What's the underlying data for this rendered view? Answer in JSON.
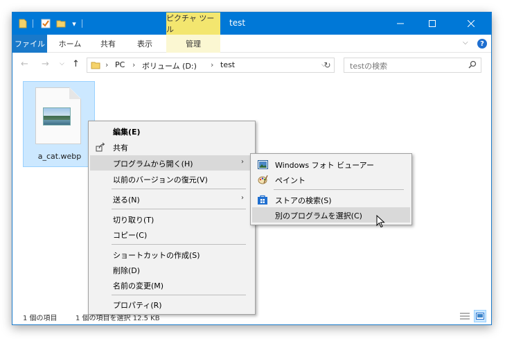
{
  "window": {
    "title": "test",
    "contextual_tab": "ピクチャ ツール",
    "qat_dropdown": "▾"
  },
  "ribbon": {
    "file": "ファイル",
    "home": "ホーム",
    "share": "共有",
    "view": "表示",
    "manage": "管理",
    "help": "?"
  },
  "address": {
    "segments": [
      "PC",
      "ボリューム (D:)",
      "test"
    ],
    "separator": "›",
    "search_placeholder": "testの検索"
  },
  "files": [
    {
      "name": "a_cat.webp",
      "icon": "image-file-icon",
      "selected": true
    }
  ],
  "status": {
    "count": "1 個の項目",
    "selected": "1 個の項目を選択  12.5 KB"
  },
  "context_menu": {
    "items": [
      {
        "label": "編集(E)",
        "bold": true
      },
      {
        "label": "共有",
        "icon": "share-icon"
      },
      {
        "label": "プログラムから開く(H)",
        "submenu": true,
        "highlighted": true
      },
      {
        "label": "以前のバージョンの復元(V)"
      },
      {
        "label": "送る(N)",
        "submenu": true
      },
      {
        "label": "切り取り(T)"
      },
      {
        "label": "コピー(C)"
      },
      {
        "label": "ショートカットの作成(S)"
      },
      {
        "label": "削除(D)"
      },
      {
        "label": "名前の変更(M)"
      },
      {
        "label": "プロパティ(R)"
      }
    ]
  },
  "submenu": {
    "items": [
      {
        "label": "Windows フォト ビューアー",
        "icon": "photo-viewer-icon"
      },
      {
        "label": "ペイント",
        "icon": "paint-icon"
      },
      {
        "label": "ストアの検索(S)",
        "icon": "store-icon"
      },
      {
        "label": "別のプログラムを選択(C)",
        "highlighted": true
      }
    ]
  },
  "colors": {
    "titlebar": "#0078d7",
    "file_tab": "#1979ca",
    "contextual": "#f3e66f",
    "selection": "#cce8ff"
  }
}
